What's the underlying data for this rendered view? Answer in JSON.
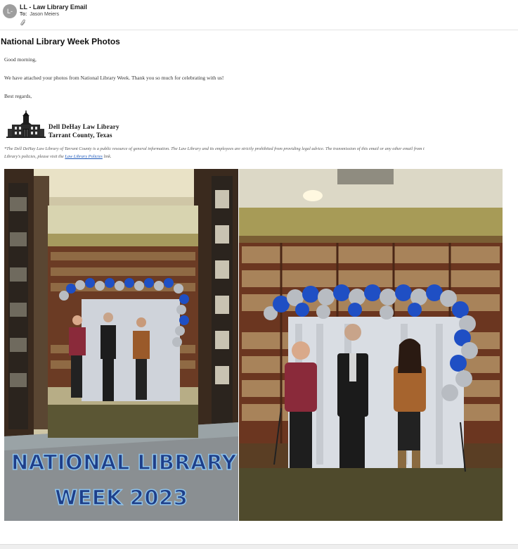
{
  "email": {
    "avatar_initials": "L-",
    "sender": "LL - Law Library Email",
    "to_label": "To:",
    "recipient": "Jason Meiers",
    "subject": "National Library Week Photos"
  },
  "body": {
    "greeting": "Good morning,",
    "message": "We have attached your photos from National Library Week. Thank you so much for celebrating with us!",
    "signoff": "Best regards,"
  },
  "signature": {
    "library_line1": "Dell DeHay Law Library",
    "library_line2": "Tarrant County, Texas",
    "disclaimer_line1": "*The Dell DeHay Law Library of Tarrant County is a public resource of general information. The Law Library and its employees are strictly prohibited from providing legal advice. The transmission of this email or any other email from t",
    "disclaimer_line2_pre": "Library's policies, please visit the ",
    "disclaimer_link": "Law Library Policies",
    "disclaimer_line2_post": " link."
  },
  "attachment": {
    "banner_line1": "NATIONAL LIBRARY",
    "banner_line2": "WEEK 2023"
  },
  "colors": {
    "link": "#1a56b8",
    "banner_text": "#1e3f8a",
    "balloon_blue": "#1f4fc4",
    "balloon_silver": "#b8bcc2"
  }
}
